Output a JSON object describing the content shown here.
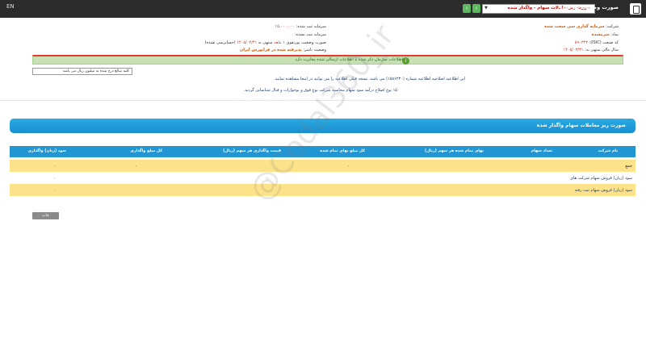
{
  "topbar": {
    "lang": "EN",
    "title": "صورت وضعیت پورتفوی",
    "select_value": "صورت ریزمعاملات سهام - واگذار شده",
    "prev": "‹",
    "next": "›"
  },
  "info": {
    "company_label": "شرکت:",
    "company_value": "سرمایه گذاری سی سخت شده",
    "symbol_label": "نماد:",
    "symbol_value": "سرمشده",
    "isic_label": "کد صنعت (ISIC):",
    "isic_value": "۵۹۰۳۴۳",
    "fiscal_label": "سال مالی منتهی به:",
    "fiscal_value": "۱۴۰۵/۰۳/۳۱",
    "registered_capital_label": "سرمایه ثبت شده:",
    "registered_capital_value": "۱۵,۰۰۰,۰۰۰",
    "unregistered_capital_label": "سرمایه ثبت نشده:",
    "unregistered_capital_value": "۰",
    "portfolio_label": "صورت وضعیت پورتفوی",
    "period": "۱ ماهه",
    "ending": "منتهی به",
    "ending_date": "۱۴۰۵/۰۳/۳۱",
    "audit_status": "(حسابرسی نشده)",
    "status_label": "وضعیت ناشر:",
    "status_value": "پذیرفته شده در فرابورس ایران"
  },
  "notice": {
    "icon": "i",
    "text": "اطلاعات سازمان ذکر شده با اطلاعات ارسالی شده مغایرت دارد"
  },
  "amount_input": {
    "value": "کلیه مبالغ درج شده به میلیون ریال می باشد"
  },
  "notes": {
    "line1": "این اطلاعیه اصلاحیه اطلاعیه شماره (۱۵۸۶۲۳۰) می باشد. نسخه قبلی اطلاعیه را می توانید در اینجا مشاهده نمایید.",
    "line2": "۱۵ نوع اصلاح درآمد سود سهام محاسبه شرکت نوع فوق و بوجوارات و قبال شناسایی گردید."
  },
  "section": {
    "title": "صورت ریز معاملات سهام واگذار شده"
  },
  "table": {
    "headers": [
      "نام شرکت",
      "تعداد سهام",
      "بهای تمام شده هر سهم (ریال)",
      "کل مبلغ بهای تمام شده",
      "قیمت واگذاری هر سهم (ریال)",
      "کل مبلغ واگذاری",
      "سود (زیان) واگذاری"
    ],
    "rows": [
      {
        "name": "جمع",
        "cost_total": "۰",
        "sale_total": "۰",
        "profit": "۰"
      },
      {
        "name": "سود (زیان) فروش سهام شرکت های",
        "cost_total": "",
        "sale_total": "",
        "profit": "۰"
      },
      {
        "name": "سود (زیان) فروش سهام ثبت رفته",
        "cost_total": "",
        "sale_total": "",
        "profit": "۰"
      }
    ]
  },
  "print_button": {
    "label": "چاپ"
  },
  "watermark": "@Codal360_ir"
}
